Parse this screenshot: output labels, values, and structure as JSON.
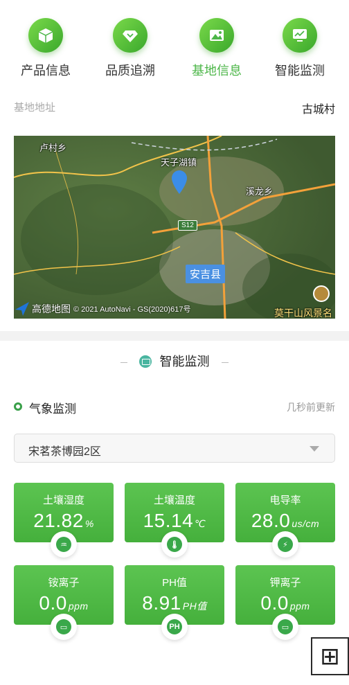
{
  "nav": {
    "items": [
      {
        "label": "产品信息",
        "icon": "cube-icon",
        "active": false
      },
      {
        "label": "品质追溯",
        "icon": "diamond-icon",
        "active": false
      },
      {
        "label": "基地信息",
        "icon": "mountain-icon",
        "active": true
      },
      {
        "label": "智能监测",
        "icon": "monitor-icon",
        "active": false
      }
    ]
  },
  "base": {
    "address_label": "基地地址",
    "address_value": "古城村"
  },
  "map": {
    "labels": {
      "lucun": "卢村乡",
      "tianzi": "天子湖镇",
      "xilong": "溪龙乡",
      "road": "S12",
      "anji": "安吉县",
      "mogan": "莫干山风景名"
    },
    "brand": "高德地图",
    "copyright": "© 2021 AutoNavi - GS(2020)617号"
  },
  "monitor": {
    "section_title": "智能监测",
    "weather_title": "气象监测",
    "updated": "几秒前更新",
    "zone_selected": "宋茗茶博园2区",
    "tiles": [
      {
        "name": "土壤湿度",
        "value": "21.82",
        "unit": "%",
        "icon": "water-drop-icon"
      },
      {
        "name": "土壤温度",
        "value": "15.14",
        "unit": "℃",
        "icon": "thermometer-icon"
      },
      {
        "name": "电导率",
        "value": "28.0",
        "unit": "us/cm",
        "icon": "lightning-icon"
      },
      {
        "name": "铵离子",
        "value": "0.0",
        "unit": "ppm",
        "icon": "sensor-icon"
      },
      {
        "name": "PH值",
        "value": "8.91",
        "unit": "PH值",
        "icon": "ph-icon"
      },
      {
        "name": "钾离子",
        "value": "0.0",
        "unit": "ppm",
        "icon": "sensor-icon"
      }
    ]
  },
  "colors": {
    "accent": "#4cb648",
    "tile": "#52b948"
  }
}
